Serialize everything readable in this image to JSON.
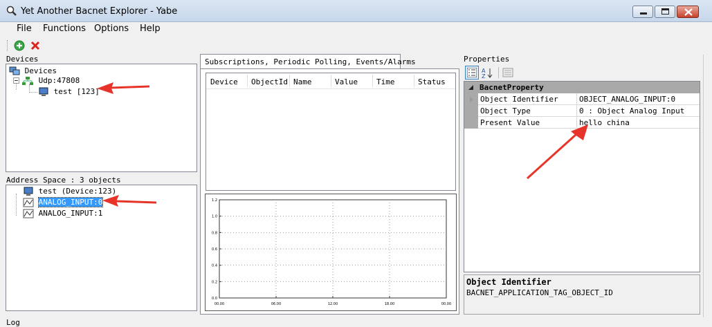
{
  "window": {
    "title": "Yet Another Bacnet Explorer - Yabe"
  },
  "menu": {
    "items": [
      "File",
      "Functions",
      "Options",
      "Help"
    ]
  },
  "devices_panel": {
    "label": "Devices",
    "tree": {
      "root": "Devices",
      "transport": "Udp:47808",
      "device": "test [123]"
    }
  },
  "address_space": {
    "label": "Address Space : 3 objects",
    "items": [
      "test (Device:123)",
      "ANALOG_INPUT:0",
      "ANALOG_INPUT:1"
    ],
    "selected_index": 1
  },
  "subscriptions": {
    "tab_label": "Subscriptions, Periodic Polling, Events/Alarms",
    "columns": [
      "Device",
      "ObjectId",
      "Name",
      "Value",
      "Time",
      "Status"
    ]
  },
  "chart_data": {
    "type": "line",
    "yticks": [
      "1.2",
      "1.0",
      "0.8",
      "0.6",
      "0.4",
      "0.2",
      "0.0"
    ],
    "xticks": [
      "00.00",
      "06.00",
      "12.00",
      "18.00",
      "00.00"
    ],
    "series": [],
    "grid": true
  },
  "properties": {
    "label": "Properties",
    "category": "BacnetProperty",
    "rows": [
      {
        "name": "Object Identifier",
        "value": "OBJECT_ANALOG_INPUT:0"
      },
      {
        "name": "Object Type",
        "value": "0 : Object Analog Input"
      },
      {
        "name": "Present Value",
        "value": "hello china"
      }
    ],
    "description": {
      "title": "Object Identifier",
      "text": "BACNET_APPLICATION_TAG_OBJECT_ID"
    }
  },
  "log": {
    "label": "Log"
  },
  "colors": {
    "arrow": "#e8332a",
    "selection": "#3399ff",
    "category_header": "#a9a9a9"
  }
}
